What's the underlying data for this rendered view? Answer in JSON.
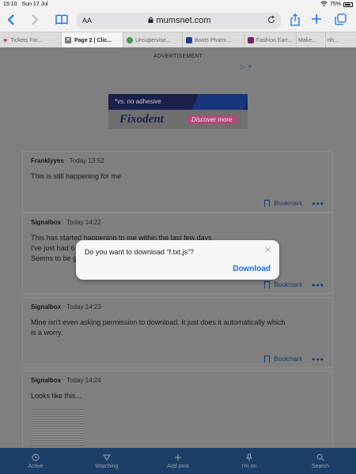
{
  "status_bar": {
    "time": "15:10",
    "date": "Sun 17 Jul",
    "battery": "75%"
  },
  "toolbar": {
    "text_size": "AA",
    "address": "mumsnet.com",
    "back_icon": "chevron-left-icon",
    "forward_icon": "chevron-right-icon",
    "bookmarks_icon": "book-icon",
    "share_icon": "share-icon",
    "new_tab_icon": "plus-icon",
    "tabs_icon": "tabs-icon"
  },
  "tabs": [
    {
      "label": "Tickets For...",
      "color": "#d0367a"
    },
    {
      "label": "Page 2 | Clic...",
      "color": "#555555",
      "active": true
    },
    {
      "label": "Unsupervise...",
      "color": "#3a9a4a"
    },
    {
      "label": "Boots Pharm...",
      "color": "#1f3d8f"
    },
    {
      "label": "Fashion Earr...",
      "color": "#7a1f66"
    },
    {
      "label": "Make...",
      "color": "#dcdcdc"
    },
    {
      "label": "rth...",
      "color": "#dcdcdc"
    }
  ],
  "ad": {
    "label": "ADVERTISEMENT",
    "tagline": "*vs. no adhesive",
    "brand": "Fixodent",
    "cta": "Discover more"
  },
  "posts": [
    {
      "author": "Franklyyes",
      "time": "Today 13:52",
      "body": [
        "This is still happening for me"
      ]
    },
    {
      "author": "Signalbox",
      "time": "Today 14:22",
      "body": [
        "This has started happening to me within the last few days",
        "I've just had 6",
        "Seems to be g"
      ]
    },
    {
      "author": "Signalbox",
      "time": "Today 14:23",
      "body": [
        "Mine isn't even asking permission to download. It just does it automatically which",
        "is a worry."
      ]
    },
    {
      "author": "Signalbox",
      "time": "Today 14:24",
      "body": [
        "Looks like this..."
      ]
    }
  ],
  "post_actions": {
    "bookmark": "Bookmark",
    "more": "•••"
  },
  "dialog": {
    "message": "Do you want to download “f.txt.js”?",
    "close": "✕",
    "action": "Download"
  },
  "bottom_nav": [
    {
      "label": "Active",
      "icon": "clock-icon"
    },
    {
      "label": "Watching",
      "icon": "watch-icon"
    },
    {
      "label": "Add post",
      "icon": "plus-icon"
    },
    {
      "label": "I'm on",
      "icon": "pin-icon"
    },
    {
      "label": "Search",
      "icon": "search-icon"
    }
  ]
}
